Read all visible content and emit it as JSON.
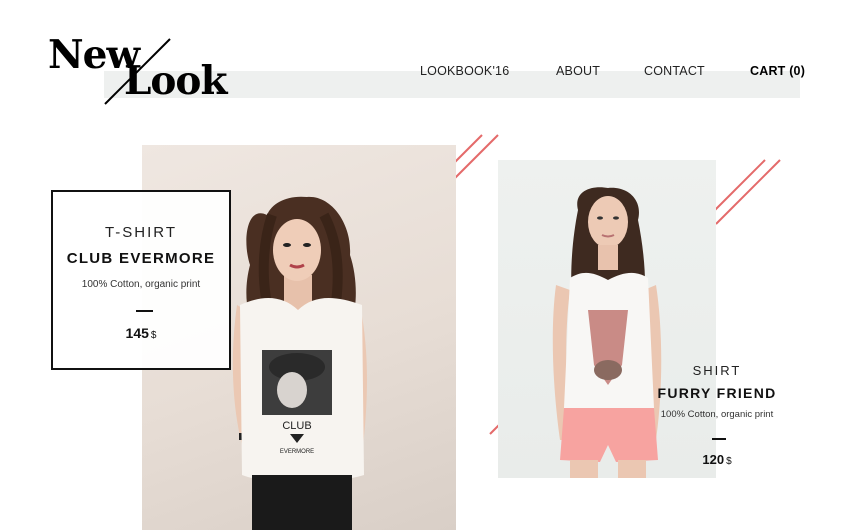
{
  "logo": {
    "top_word": "New",
    "bottom_word": "Look"
  },
  "nav": {
    "lookbook": "LOOKBOOK'16",
    "about": "ABOUT",
    "contact": "CONTACT",
    "cart": "CART (0)"
  },
  "products": [
    {
      "category": "T-SHIRT",
      "name": "CLUB EVERMORE",
      "description": "100% Cotton, organic print",
      "price": "145",
      "currency": "$",
      "print_text_top": "CLUB",
      "print_text_bottom": "EVERMORE"
    },
    {
      "category": "SHIRT",
      "name": "FURRY FRIEND",
      "description": "100% Cotton, organic print",
      "price": "120",
      "currency": "$"
    }
  ],
  "colors": {
    "accent_line": "#e46a6a",
    "logo_bar": "#eef0ef",
    "text": "#111111",
    "shorts": "#f7a3a0"
  }
}
